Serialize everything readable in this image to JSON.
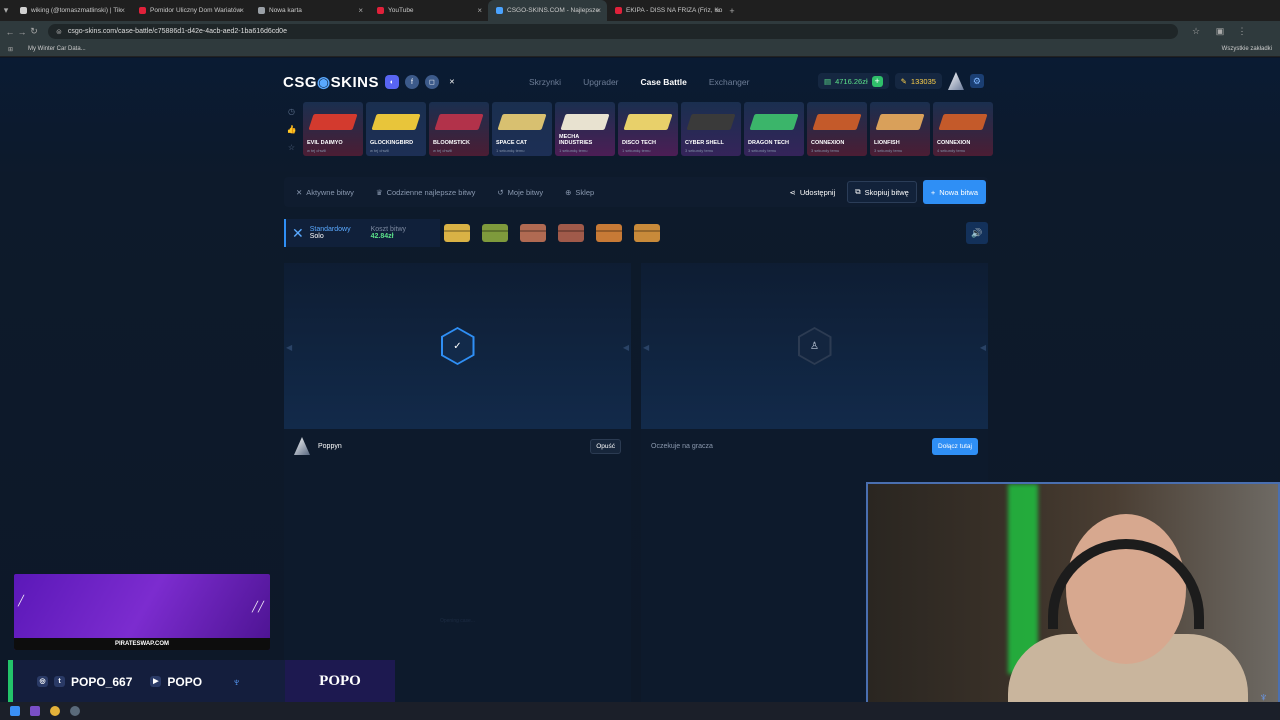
{
  "browser": {
    "tabs": [
      {
        "title": "wiking (@tomaszmatlinski) | Tik",
        "fav": "#d0d0d0"
      },
      {
        "title": "Pomidor Uliczny Dom Wariatów",
        "fav": "#e0213a"
      },
      {
        "title": "Nowa karta",
        "fav": "#9aa0a6"
      },
      {
        "title": "YouTube",
        "fav": "#e0213a"
      },
      {
        "title": "CSGO-SKINS.COM - Najlepsze",
        "fav": "#4aa3ff"
      },
      {
        "title": "EKIPA - DISS NA FRIZA (Friz, Ko",
        "fav": "#e0213a"
      }
    ],
    "url": "csgo-skins.com/case-battle/c75886d1-d42e-4acb-aed2-1ba616d6cd0e",
    "bookmark": "My Winter Car Data...",
    "bookmarks_right": "Wszystkie zakładki"
  },
  "site": {
    "logo_a": "CSG",
    "logo_b": "SKINS",
    "menu": [
      "Skrzynki",
      "Upgrader",
      "Case Battle",
      "Exchanger"
    ],
    "balance": "4716.26zł",
    "coins": "133035"
  },
  "drops": [
    {
      "name": "EVIL DAIMYO",
      "sub": "w tej chwili",
      "bg": "r-red",
      "gun": "#d33a2e"
    },
    {
      "name": "GLOCKINGBIRD",
      "sub": "w tej chwili",
      "bg": "r-blue",
      "gun": "#e8c53a"
    },
    {
      "name": "BLOOMSTICK",
      "sub": "w tej chwili",
      "bg": "r-red",
      "gun": "#b2324a"
    },
    {
      "name": "SPACE CAT",
      "sub": "1 sekundę temu",
      "bg": "r-blue",
      "gun": "#d8c070"
    },
    {
      "name": "MECHA INDUSTRIES",
      "sub": "1 sekundę temu",
      "bg": "r-pink",
      "gun": "#e8e2d0"
    },
    {
      "name": "DISCO TECH",
      "sub": "1 sekundę temu",
      "bg": "r-pink",
      "gun": "#e8d06a"
    },
    {
      "name": "CYBER SHELL",
      "sub": "3 sekundy temu",
      "bg": "r-purple",
      "gun": "#3a3a3a"
    },
    {
      "name": "DRAGON TECH",
      "sub": "3 sekundy temu",
      "bg": "r-purple",
      "gun": "#3bb56a"
    },
    {
      "name": "CONNEXION",
      "sub": "3 sekundy temu",
      "bg": "r-red",
      "gun": "#c45a2a"
    },
    {
      "name": "LIONFISH",
      "sub": "3 sekundy temu",
      "bg": "r-red",
      "gun": "#d9a05a"
    },
    {
      "name": "CONNEXION",
      "sub": "4 sekundy temu",
      "bg": "r-red",
      "gun": "#c45a2a"
    }
  ],
  "battlebar": {
    "items": [
      "Aktywne bitwy",
      "Codzienne najlepsze bitwy",
      "Moje bitwy",
      "Sklep"
    ],
    "share": "Udostępnij",
    "copy": "Skopiuj bitwę",
    "new": "Nowa bitwa"
  },
  "mode": {
    "type": "Standardowy",
    "variant": "Solo",
    "cost_label": "Koszt bitwy",
    "cost": "42.84zł"
  },
  "cases": [
    "#d9b245",
    "#7e9a3c",
    "#b06a52",
    "#a05a4a",
    "#c77a36",
    "#c88a3a"
  ],
  "players": [
    {
      "name": "Poppyn",
      "action": "Opuść"
    },
    {
      "status": "Oczekuje na gracza",
      "action": "Dołącz tutaj"
    }
  ],
  "ghost_text": "Opening case...",
  "overlay": {
    "promo": "PIRATESWAP.COM",
    "handle1": "POPO_667",
    "handle2": "POPO",
    "brand": "POPO"
  }
}
